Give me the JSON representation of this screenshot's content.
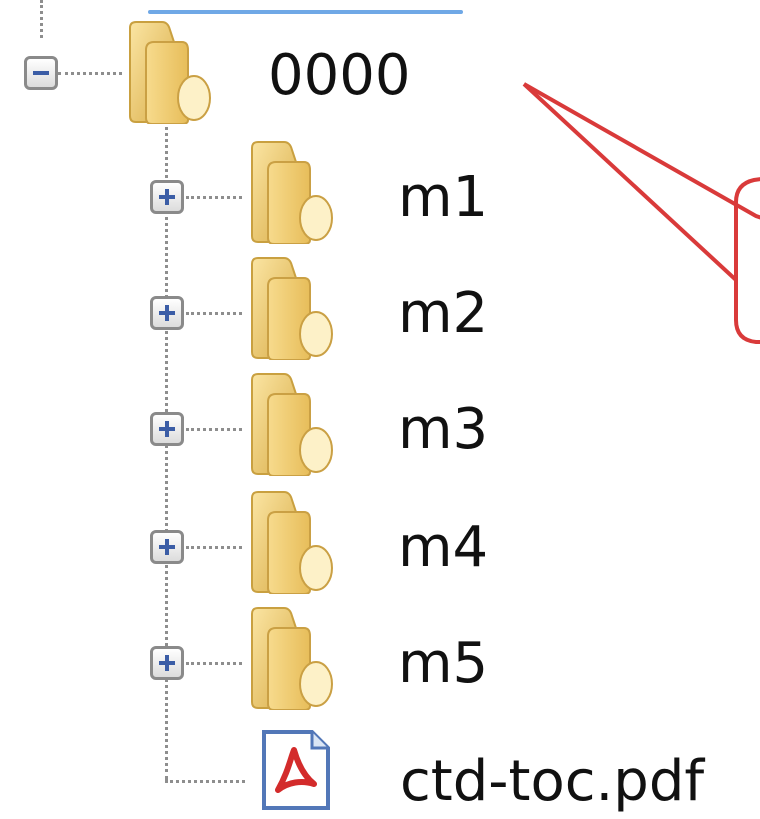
{
  "tree": {
    "root": {
      "label": "0000",
      "state": "expanded",
      "icon": "folder-icon"
    },
    "children": [
      {
        "label": "m1",
        "state": "collapsed",
        "icon": "folder-icon"
      },
      {
        "label": "m2",
        "state": "collapsed",
        "icon": "folder-icon"
      },
      {
        "label": "m3",
        "state": "collapsed",
        "icon": "folder-icon"
      },
      {
        "label": "m4",
        "state": "collapsed",
        "icon": "folder-icon"
      },
      {
        "label": "m5",
        "state": "collapsed",
        "icon": "folder-icon"
      }
    ],
    "file": {
      "label": "ctd-toc.pdf",
      "icon": "pdf-file-icon"
    }
  },
  "colors": {
    "folder": "#f3d27a",
    "folder_dark": "#d7a83c",
    "expander_sign": "#3b5da6",
    "callout": "#d93a3a",
    "selection_bar": "#6fa8e6"
  }
}
